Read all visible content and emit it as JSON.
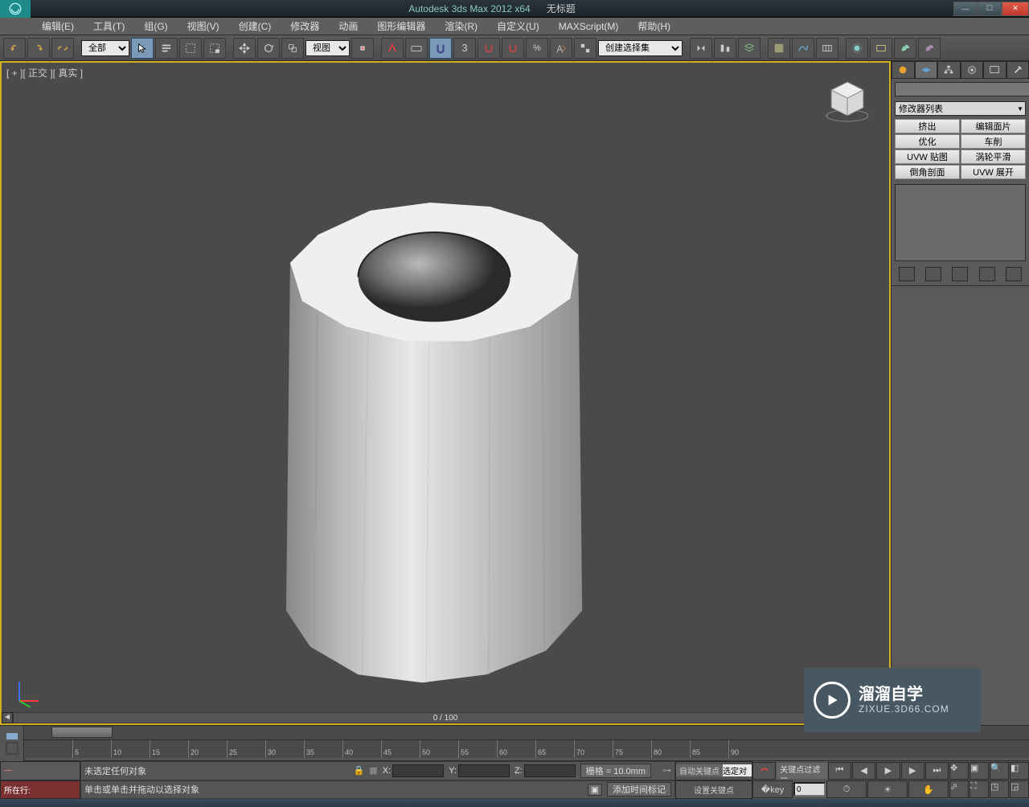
{
  "title": {
    "app": "Autodesk 3ds Max  2012 x64",
    "doc": "无标题"
  },
  "menu": {
    "edit": "编辑(E)",
    "tools": "工具(T)",
    "group": "组(G)",
    "views": "视图(V)",
    "create": "创建(C)",
    "modifiers": "修改器",
    "animation": "动画",
    "graph": "图形编辑器",
    "render": "渲染(R)",
    "customize": "自定义(U)",
    "maxscript": "MAXScript(M)",
    "help": "帮助(H)"
  },
  "toolbar": {
    "filter": "全部",
    "refcoord": "视图",
    "snap_digit": "3",
    "named_set": "创建选择集"
  },
  "viewport": {
    "label": "[ + ][ 正交 ][ 真实 ]",
    "frame_display": "0 / 100"
  },
  "cmd_panel": {
    "modifier_list": "修改器列表",
    "btns": {
      "extrude": "挤出",
      "edit_patch": "编辑面片",
      "optimize": "优化",
      "lathe": "车削",
      "uvw_map": "UVW 贴图",
      "turbo": "涡轮平滑",
      "chamfer": "倒角剖面",
      "uvw_unwrap": "UVW 展开"
    }
  },
  "timeline": {
    "ticks": [
      "5",
      "10",
      "15",
      "20",
      "25",
      "30",
      "35",
      "40",
      "45",
      "50",
      "55",
      "60",
      "65",
      "70",
      "75",
      "80",
      "85",
      "90"
    ]
  },
  "status": {
    "now_line": "所在行:",
    "no_sel": "未选定任何对象",
    "prompt": "单击或单击并拖动以选择对象",
    "x": "X:",
    "y": "Y:",
    "z": "Z:",
    "grid": "栅格 = 10.0mm",
    "auto_key": "自动关键点",
    "set_key": "设置关键点",
    "selected": "选定对",
    "key_filter": "关键点过滤器...",
    "time_tag": "添加时间标记",
    "frame": "0"
  },
  "watermark": {
    "line1": "溜溜自学",
    "line2": "ZIXUE.3D66.COM"
  }
}
